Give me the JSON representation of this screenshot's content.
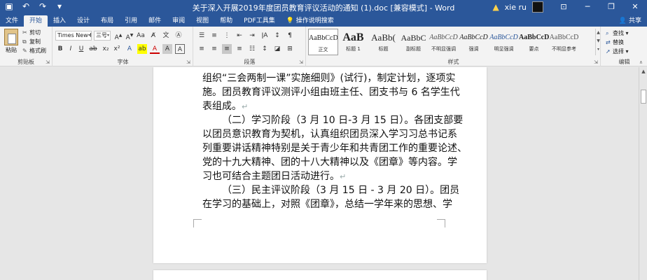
{
  "titlebar": {
    "title": "关于深入开展2019年度团员教育评议活动的通知 (1).doc [兼容模式] - Word",
    "user": "xie ru",
    "qat_icons": [
      "save-icon",
      "undo-icon",
      "redo-icon",
      "customize-icon"
    ]
  },
  "tabs": {
    "items": [
      "文件",
      "开始",
      "插入",
      "设计",
      "布局",
      "引用",
      "邮件",
      "审阅",
      "视图",
      "帮助",
      "PDF工具集"
    ],
    "tell_me": "操作说明搜索",
    "share": "共享"
  },
  "ribbon": {
    "clipboard": {
      "label": "剪贴板",
      "paste": "粘贴",
      "cut": "剪切",
      "copy": "复制",
      "format_painter": "格式刷"
    },
    "font": {
      "label": "字体",
      "font_name": "Times New R",
      "font_size": "三号"
    },
    "paragraph": {
      "label": "段落"
    },
    "styles": {
      "label": "样式",
      "items": [
        {
          "preview": "AaBbCcD",
          "name": "正文"
        },
        {
          "preview": "AaB",
          "name": "标题 1"
        },
        {
          "preview": "AaBb(",
          "name": "标题"
        },
        {
          "preview": "AaBbC",
          "name": "副标题"
        },
        {
          "preview": "AaBbCcD",
          "name": "不明显强调"
        },
        {
          "preview": "AaBbCcD",
          "name": "强调"
        },
        {
          "preview": "AaBbCcD",
          "name": "明显强调"
        },
        {
          "preview": "AaBbCcD",
          "name": "要点"
        },
        {
          "preview": "AaBbCcD",
          "name": "不明显参考"
        }
      ]
    },
    "editing": {
      "label": "编辑",
      "find": "查找",
      "replace": "替换",
      "select": "选择"
    }
  },
  "document": {
    "lines": [
      "组织“三会两制一课”实施细则》(试行)，制定计划，逐项实",
      "施。团员教育评议测评小组由班主任、团支书与 6 名学生代",
      "表组成。",
      "（二）学习阶段（3 月 10 日-3 月 15 日）。各团支部要",
      "以团员意识教育为契机，认真组织团员深入学习习总书记系",
      "列重要讲话精神特别是关于青少年和共青团工作的重要论述、",
      "党的十九大精神、团的十八大精神以及《团章》等内容。学",
      "习也可结合主题团日活动进行。",
      "（三）民主评议阶段（3 月 15 日 - 3 月 20 日）。团员",
      "在学习的基础上，对照《团章》，总结一学年来的思想、学"
    ]
  }
}
